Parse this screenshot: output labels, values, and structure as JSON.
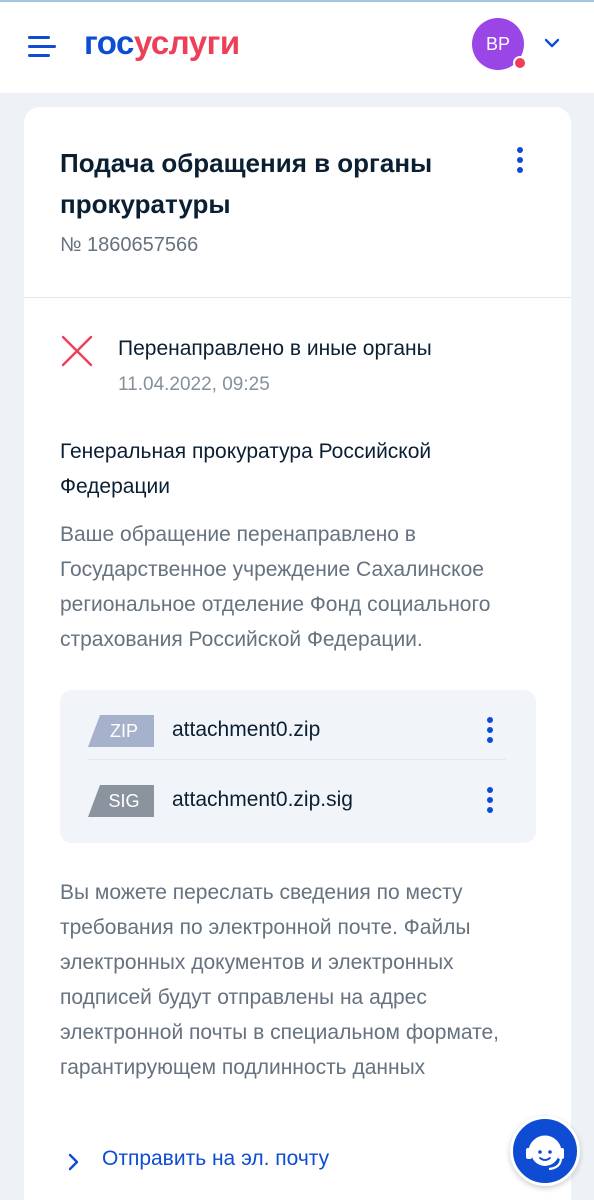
{
  "header": {
    "logo_part1": "гос",
    "logo_part2": "услуги",
    "avatar_initials": "ВР"
  },
  "card": {
    "title": "Подача обращения в органы прокуратуры",
    "number": "№ 1860657566",
    "status": {
      "text": "Перенаправлено в иные органы",
      "date": "11.04.2022, 09:25",
      "icon": "cross-icon",
      "color": "#ee3f58"
    },
    "organization": "Генеральная прокуратура Российской Федерации",
    "description": "Ваше обращение перенаправлено в Государственное учреждение Сахалинское региональное отделение Фонд социального страхования Российской Федерации.",
    "files": [
      {
        "type": "ZIP",
        "name": "attachment0.zip",
        "badge_color": "#a6b2cc"
      },
      {
        "type": "SIG",
        "name": "attachment0.zip.sig",
        "badge_color": "#8a939e"
      }
    ],
    "info": "Вы можете переслать сведения по месту требования по электронной почте. Файлы электронных документов и электронных подписей будут отправлены на адрес электронной почты в специальном формате, гарантирующем подлинность данных",
    "send_link": "Отправить на эл. почту"
  },
  "colors": {
    "accent": "#0d4cd3",
    "brand_red": "#ee3f58",
    "avatar": "#9a45e6"
  }
}
